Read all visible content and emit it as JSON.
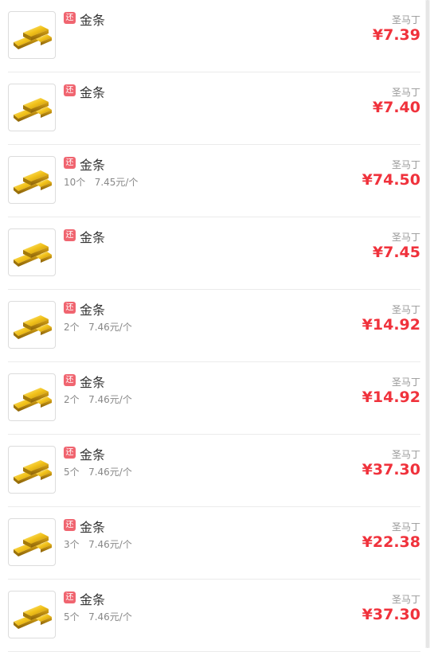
{
  "items": [
    {
      "badge": "还",
      "name": "金条",
      "sub": "",
      "seller": "圣马丁",
      "price": "¥7.39"
    },
    {
      "badge": "还",
      "name": "金条",
      "sub": "",
      "seller": "圣马丁",
      "price": "¥7.40"
    },
    {
      "badge": "还",
      "name": "金条",
      "sub": "10个   7.45元/个",
      "seller": "圣马丁",
      "price": "¥74.50"
    },
    {
      "badge": "还",
      "name": "金条",
      "sub": "",
      "seller": "圣马丁",
      "price": "¥7.45"
    },
    {
      "badge": "还",
      "name": "金条",
      "sub": "2个   7.46元/个",
      "seller": "圣马丁",
      "price": "¥14.92"
    },
    {
      "badge": "还",
      "name": "金条",
      "sub": "2个   7.46元/个",
      "seller": "圣马丁",
      "price": "¥14.92"
    },
    {
      "badge": "还",
      "name": "金条",
      "sub": "5个   7.46元/个",
      "seller": "圣马丁",
      "price": "¥37.30"
    },
    {
      "badge": "还",
      "name": "金条",
      "sub": "3个   7.46元/个",
      "seller": "圣马丁",
      "price": "¥22.38"
    },
    {
      "badge": "还",
      "name": "金条",
      "sub": "5个   7.46元/个",
      "seller": "圣马丁",
      "price": "¥37.30"
    }
  ],
  "icons": {
    "thumbnail": "gold-bar-icon"
  },
  "colors": {
    "price": "#f0323c",
    "badge": "#f06570"
  }
}
